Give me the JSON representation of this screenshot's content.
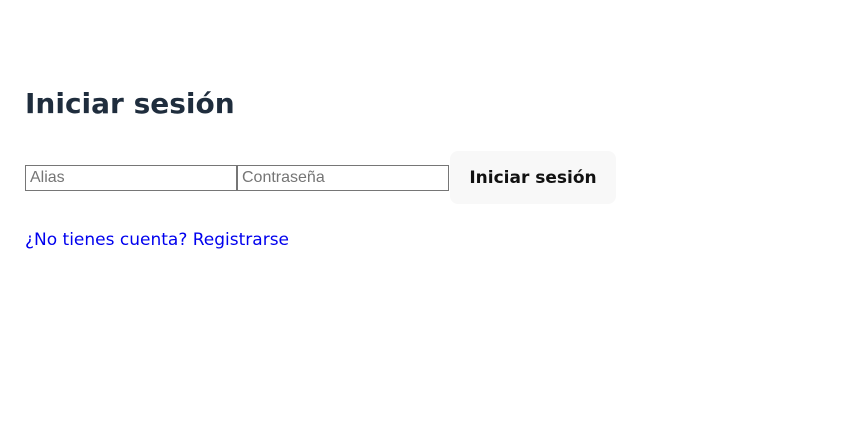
{
  "page": {
    "title": "Iniciar sesión"
  },
  "form": {
    "alias_placeholder": "Alias",
    "alias_value": "",
    "password_placeholder": "Contraseña",
    "password_value": "",
    "submit_label": "Iniciar sesión"
  },
  "footer": {
    "register_link": "¿No tienes cuenta? Registrarse"
  },
  "colors": {
    "title": "#1f2d3d",
    "link": "#0000ee",
    "button_background": "#f8f8f8",
    "input_border": "#767676"
  }
}
